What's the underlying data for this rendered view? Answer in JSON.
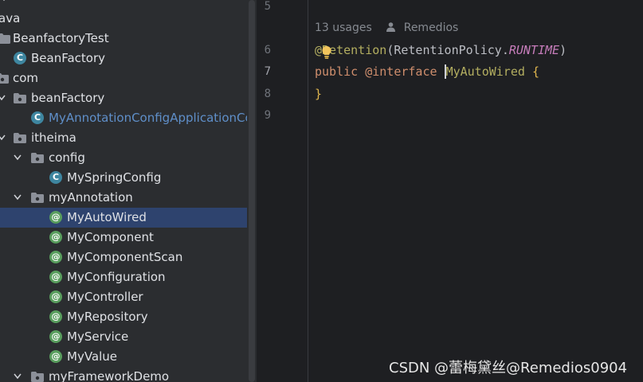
{
  "tree": {
    "rows": [
      {
        "label": "",
        "icon": "chevron-down-icon"
      },
      {
        "label": "ava"
      },
      {
        "label": "BeanfactoryTest",
        "icon": "folder-icon"
      },
      {
        "label": "BeanFactory",
        "icon": "class-icon"
      },
      {
        "label": "com",
        "icon": "package-icon"
      },
      {
        "label": "beanFactory",
        "icon": "package-icon"
      },
      {
        "label": "MyAnnotationConfigApplicationCon",
        "icon": "class-icon"
      },
      {
        "label": "itheima",
        "icon": "package-icon"
      },
      {
        "label": "config",
        "icon": "package-icon"
      },
      {
        "label": "MySpringConfig",
        "icon": "class-icon"
      },
      {
        "label": "myAnnotation",
        "icon": "package-icon"
      },
      {
        "label": "MyAutoWired",
        "icon": "annotation-icon"
      },
      {
        "label": "MyComponent",
        "icon": "annotation-icon"
      },
      {
        "label": "MyComponentScan",
        "icon": "annotation-icon"
      },
      {
        "label": "MyConfiguration",
        "icon": "annotation-icon"
      },
      {
        "label": "MyController",
        "icon": "annotation-icon"
      },
      {
        "label": "MyRepository",
        "icon": "annotation-icon"
      },
      {
        "label": "MyService",
        "icon": "annotation-icon"
      },
      {
        "label": "MyValue",
        "icon": "annotation-icon"
      },
      {
        "label": "myFrameworkDemo",
        "icon": "package-icon"
      }
    ],
    "selected": "MyAutoWired"
  },
  "editor": {
    "line_numbers": [
      "5",
      "6",
      "7",
      "8",
      "9"
    ],
    "current_line": "7",
    "inlay": {
      "usages": "13 usages",
      "author": "Remedios"
    },
    "code": {
      "line6": {
        "at": "@",
        "name": "Retention",
        "open": "(",
        "cls": "RetentionPolicy",
        "dot": ".",
        "const": "RUNTIME",
        "close": ")"
      },
      "line7": {
        "kw": "public",
        "ann": "@interface",
        "name": "MyAutoWired",
        "brace": "{"
      },
      "line8": {
        "brace": "}"
      }
    }
  },
  "watermark": "CSDN @蕾梅黛丝@Remedios0904",
  "colors": {
    "tree_bg": "#2b2d30",
    "editor_bg": "#1e1f22",
    "selection": "#2e436e",
    "keyword": "#cf8e6d",
    "annotation": "#b3ae60",
    "constant": "#c77dbb",
    "class_icon": "#3e86a0",
    "annotation_icon": "#599e5e"
  }
}
